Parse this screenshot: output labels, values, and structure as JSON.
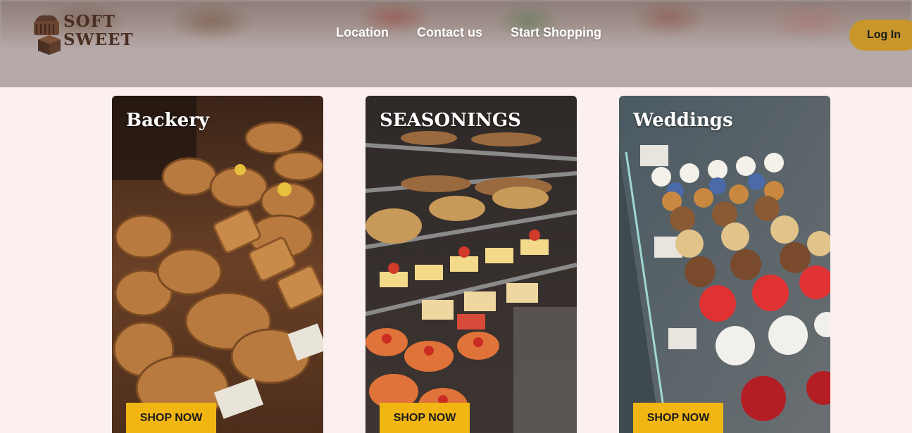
{
  "header": {
    "logo": {
      "line1": "SOFT",
      "line2": "SWEET"
    },
    "nav": [
      {
        "label": "Location"
      },
      {
        "label": "Contact us"
      },
      {
        "label": "Start Shopping"
      }
    ],
    "login_label": "Log In"
  },
  "cards": [
    {
      "title": "Backery",
      "button": "SHOP NOW"
    },
    {
      "title": "SEASONINGS",
      "button": "SHOP NOW"
    },
    {
      "title": "Weddings",
      "button": "SHOP NOW"
    }
  ],
  "colors": {
    "page_bg": "#fbf0ef",
    "header_bg": "#b5a9a9",
    "login_bg": "#c9962b",
    "shop_button_bg": "#f2b613",
    "logo_text": "#4a2f22"
  }
}
